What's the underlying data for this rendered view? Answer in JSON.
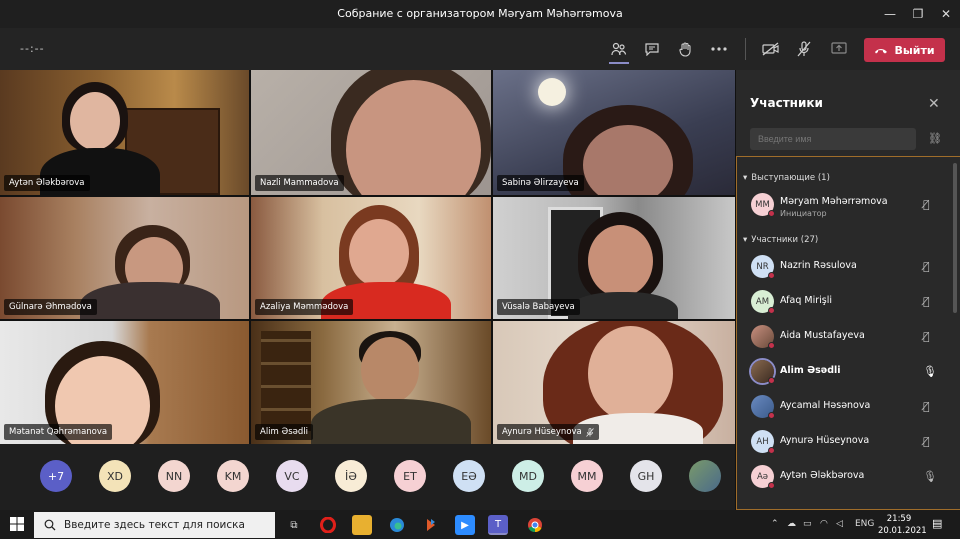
{
  "window": {
    "title": "Собрание с организатором Məryam Məhərrəmova",
    "minimize": "—",
    "maximize": "❐",
    "close": "✕"
  },
  "toolbar": {
    "timer": "--:--",
    "leave_label": "Выйти",
    "icons": [
      "participants-icon",
      "chat-icon",
      "raise-hand-icon",
      "more-icon",
      "camera-off-icon",
      "mic-off-icon",
      "share-screen-icon"
    ]
  },
  "tiles": [
    {
      "name": "Aytən Ələkbərova"
    },
    {
      "name": "Nazli Mammadova"
    },
    {
      "name": "Sabinə Əlirzayeva"
    },
    {
      "name": "Gülnarə Əhmədova"
    },
    {
      "name": "Azaliya Məmmədova"
    },
    {
      "name": "Vüsalə Babayeva"
    },
    {
      "name": "Mətanət Qəhrəmanova"
    },
    {
      "name": "Alim Əsədli"
    },
    {
      "name": "Aynurə Hüseynova"
    }
  ],
  "strip": {
    "avatars": [
      "+7",
      "XD",
      "NN",
      "KM",
      "VC",
      "İƏ",
      "ET",
      "EƏ",
      "MD",
      "MM",
      "GH"
    ]
  },
  "panel": {
    "title": "Участники",
    "search_placeholder": "Введите имя",
    "presenters_label": "Выступающие (1)",
    "attendees_label": "Участники (27)",
    "presenter": {
      "initials": "MM",
      "name": "Məryam Məhərrəmova",
      "role": "Инициатор"
    },
    "attendees": [
      {
        "initials": "NR",
        "name": "Nazrin Rəsulova",
        "mic": "muted"
      },
      {
        "initials": "AM",
        "name": "Afaq Mirişli",
        "mic": "muted"
      },
      {
        "initials": "",
        "name": "Aida Mustafayeva",
        "mic": "muted"
      },
      {
        "initials": "",
        "name": "Alim Əsədli",
        "mic": "on"
      },
      {
        "initials": "",
        "name": "Aycamal Həsənova",
        "mic": "muted"
      },
      {
        "initials": "AH",
        "name": "Aynurə Hüseynova",
        "mic": "muted"
      },
      {
        "initials": "Aə",
        "name": "Aytən Ələkbərova",
        "mic": "on"
      }
    ]
  },
  "taskbar": {
    "search_placeholder": "Введите здесь текст для поиска",
    "lang": "ENG",
    "time": "21:59",
    "date": "20.01.2021"
  },
  "colors": {
    "accent": "#8b8cc7",
    "leave": "#c4314b",
    "panel_border": "#a06d2a"
  }
}
